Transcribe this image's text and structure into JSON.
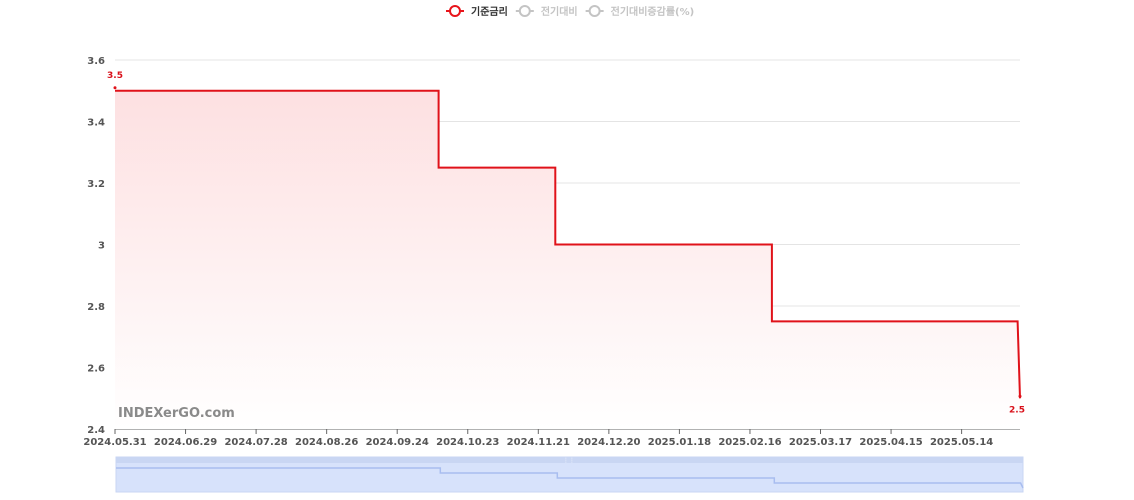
{
  "legend": [
    {
      "label": "기준금리",
      "active": true,
      "color": "#e8141b"
    },
    {
      "label": "전기대비",
      "active": false,
      "color": "#c4c4c4"
    },
    {
      "label": "전기대비증감률(%)",
      "active": false,
      "color": "#c4c4c4"
    }
  ],
  "watermark": "INDEXerGO.com",
  "colors": {
    "line": "#e0121a",
    "area": "#fde3e4",
    "grid": "#e4e4e4",
    "slider": "#d7e2fb",
    "slider_line": "#a8bdf0"
  },
  "chart_data": {
    "type": "line",
    "step": true,
    "x_ticks": [
      "2024.05.31",
      "2024.06.29",
      "2024.07.28",
      "2024.08.26",
      "2024.09.24",
      "2024.10.23",
      "2024.11.21",
      "2024.12.20",
      "2025.01.18",
      "2025.02.16",
      "2025.03.17",
      "2025.04.15",
      "2025.05.14"
    ],
    "y_ticks": [
      "2.4",
      "2.6",
      "2.8",
      "3",
      "3.2",
      "3.4",
      "3.6"
    ],
    "ylim": [
      2.4,
      3.6
    ],
    "xlim": [
      "2024.05.31",
      "2025.06.07"
    ],
    "series": [
      {
        "name": "기준금리",
        "points": [
          {
            "x": "2024.05.31",
            "y": 3.5
          },
          {
            "x": "2024.10.11",
            "y": 3.5
          },
          {
            "x": "2024.10.11",
            "y": 3.25
          },
          {
            "x": "2024.11.28",
            "y": 3.25
          },
          {
            "x": "2024.11.28",
            "y": 3.0
          },
          {
            "x": "2025.02.25",
            "y": 3.0
          },
          {
            "x": "2025.02.25",
            "y": 2.75
          },
          {
            "x": "2025.06.06",
            "y": 2.75
          },
          {
            "x": "2025.06.07",
            "y": 2.5
          }
        ]
      }
    ],
    "start_label": "3.5",
    "end_label": "2.5",
    "grid": true,
    "legend_position": "top-center",
    "data_zoom": true
  }
}
